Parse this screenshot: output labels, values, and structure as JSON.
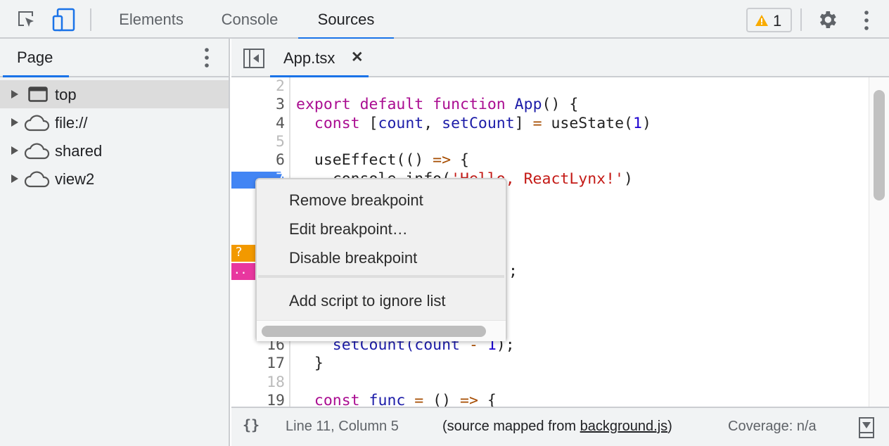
{
  "toolbar": {
    "tabs": [
      {
        "label": "Elements"
      },
      {
        "label": "Console"
      },
      {
        "label": "Sources",
        "active": true
      }
    ],
    "warning_count": "1",
    "icons": [
      "inspect-element-icon",
      "device-toolbar-icon",
      "warning-icon",
      "gear-icon",
      "more-vert-icon"
    ]
  },
  "sidebar": {
    "tab": "Page",
    "items": [
      {
        "label": "top",
        "icon": "frame-icon",
        "selected": true
      },
      {
        "label": "file://",
        "icon": "cloud-icon"
      },
      {
        "label": "shared",
        "icon": "cloud-icon"
      },
      {
        "label": "view2",
        "icon": "cloud-icon"
      }
    ]
  },
  "editor": {
    "file_tab": "App.tsx",
    "close": "✕"
  },
  "code": {
    "lines": [
      {
        "n": "2"
      },
      {
        "n": "3"
      },
      {
        "n": "4"
      },
      {
        "n": "5"
      },
      {
        "n": "6"
      },
      {
        "n": "7"
      },
      {
        "n": "16"
      },
      {
        "n": "17"
      },
      {
        "n": "18"
      },
      {
        "n": "19"
      }
    ],
    "l3": [
      "export",
      " default",
      " function",
      " App",
      "() {"
    ],
    "l4": [
      "  const",
      " [",
      "count",
      ", ",
      "setCount",
      "] ",
      "=",
      " useState(",
      "1",
      ")"
    ],
    "l6": [
      "  useEffect(() ",
      "=>",
      " {"
    ],
    "l7": [
      "    console.info(",
      "'Hello, ReactLynx!'",
      ")"
    ],
    "l12_tail": ";",
    "l16": [
      "    setCount(",
      "count",
      " -",
      " 1",
      ");"
    ],
    "l17": "  }",
    "l19": [
      "  const",
      " func",
      " =",
      " () ",
      "=>",
      " {"
    ],
    "marker_orange": "?",
    "marker_pink": "..",
    "colors": {
      "breakpoint": "#4285f4",
      "orange": "#f29900",
      "pink": "#e8379f"
    }
  },
  "context_menu": {
    "items": [
      "Remove breakpoint",
      "Edit breakpoint…",
      "Disable breakpoint",
      "Add script to ignore list"
    ]
  },
  "status": {
    "position": "Line 11, Column 5",
    "mapped_prefix": "(source mapped from ",
    "mapped_link": "background.js",
    "mapped_suffix": ")",
    "coverage": "Coverage: n/a"
  }
}
